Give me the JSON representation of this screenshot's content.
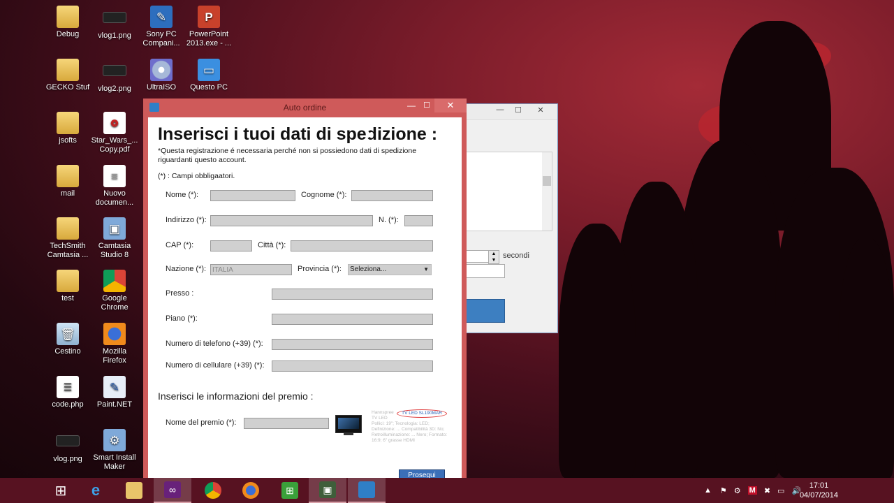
{
  "desktop": {
    "icons": [
      {
        "label": "Debug",
        "icon": "folder-icon"
      },
      {
        "label": "vlog1.png",
        "icon": "image-file-icon"
      },
      {
        "label": "Sony PC Compani...",
        "icon": "app-shortcut-icon"
      },
      {
        "label": "PowerPoint 2013.exe - ...",
        "icon": "powerpoint-icon"
      },
      {
        "label": "GECKO Stuf",
        "icon": "folder-icon"
      },
      {
        "label": "vlog2.png",
        "icon": "image-file-icon"
      },
      {
        "label": "UltraISO",
        "icon": "disc-icon"
      },
      {
        "label": "Questo PC",
        "icon": "computer-icon"
      },
      {
        "label": "jsofts",
        "icon": "folder-icon"
      },
      {
        "label": "Star_Wars_... Copy.pdf",
        "icon": "pdf-icon"
      },
      {
        "label": "mail",
        "icon": "folder-icon"
      },
      {
        "label": "Nuovo documen...",
        "icon": "document-icon"
      },
      {
        "label": "TechSmith Camtasia ...",
        "icon": "folder-icon"
      },
      {
        "label": "Camtasia Studio 8",
        "icon": "camtasia-icon"
      },
      {
        "label": "test",
        "icon": "folder-icon"
      },
      {
        "label": "Google Chrome",
        "icon": "chrome-icon"
      },
      {
        "label": "Cestino",
        "icon": "recycle-bin-icon"
      },
      {
        "label": "Mozilla Firefox",
        "icon": "firefox-icon"
      },
      {
        "label": "code.php",
        "icon": "php-file-icon"
      },
      {
        "label": "Paint.NET",
        "icon": "paint-icon"
      },
      {
        "label": "vlog.png",
        "icon": "image-file-icon"
      },
      {
        "label": "Smart Install Maker",
        "icon": "installer-icon"
      }
    ]
  },
  "background_window": {
    "secondi_label": "secondi"
  },
  "window": {
    "title": "Auto ordine",
    "heading": "Inserisci i tuoi dati di spedizione :",
    "note": "*Questa registrazione é necessaria perché non si possiedono dati di spedizione riguardanti questo account.",
    "required_note": "(*) : Campi obbligaatori.",
    "labels": {
      "nome": "Nome (*):",
      "cognome": "Cognome (*):",
      "indirizzo": "Indirizzo (*):",
      "numero": "N. (*):",
      "cap": "CAP (*):",
      "citta": "Città (*):",
      "nazione": "Nazione (*):",
      "provincia": "Provincia (*):",
      "presso": "Presso :",
      "piano": "Piano (*):",
      "telefono": "Numero di telefono (+39) (*):",
      "cellulare": "Numero di cellulare (+39) (*):",
      "premio": "Nome del premio (*):"
    },
    "values": {
      "nazione": "ITALIA",
      "provincia": "Seleziona..."
    },
    "prize_heading": "Inserisci le informazioni del premio :",
    "prize_card": {
      "brand": "Hannspree",
      "model": "TV LED SL190MAR",
      "type": "TV LED",
      "specs": "Pollici: 19\"; Tecnologia: LED; Definizione: ... Compatibilità 3D: No; Retroilluminazione: ... Nero; Formato: 16:9; 6\" grasse HDMI"
    },
    "submit_label": "Prosegui"
  },
  "taskbar": {
    "clock_time": "17:01",
    "clock_date": "04/07/2014"
  }
}
